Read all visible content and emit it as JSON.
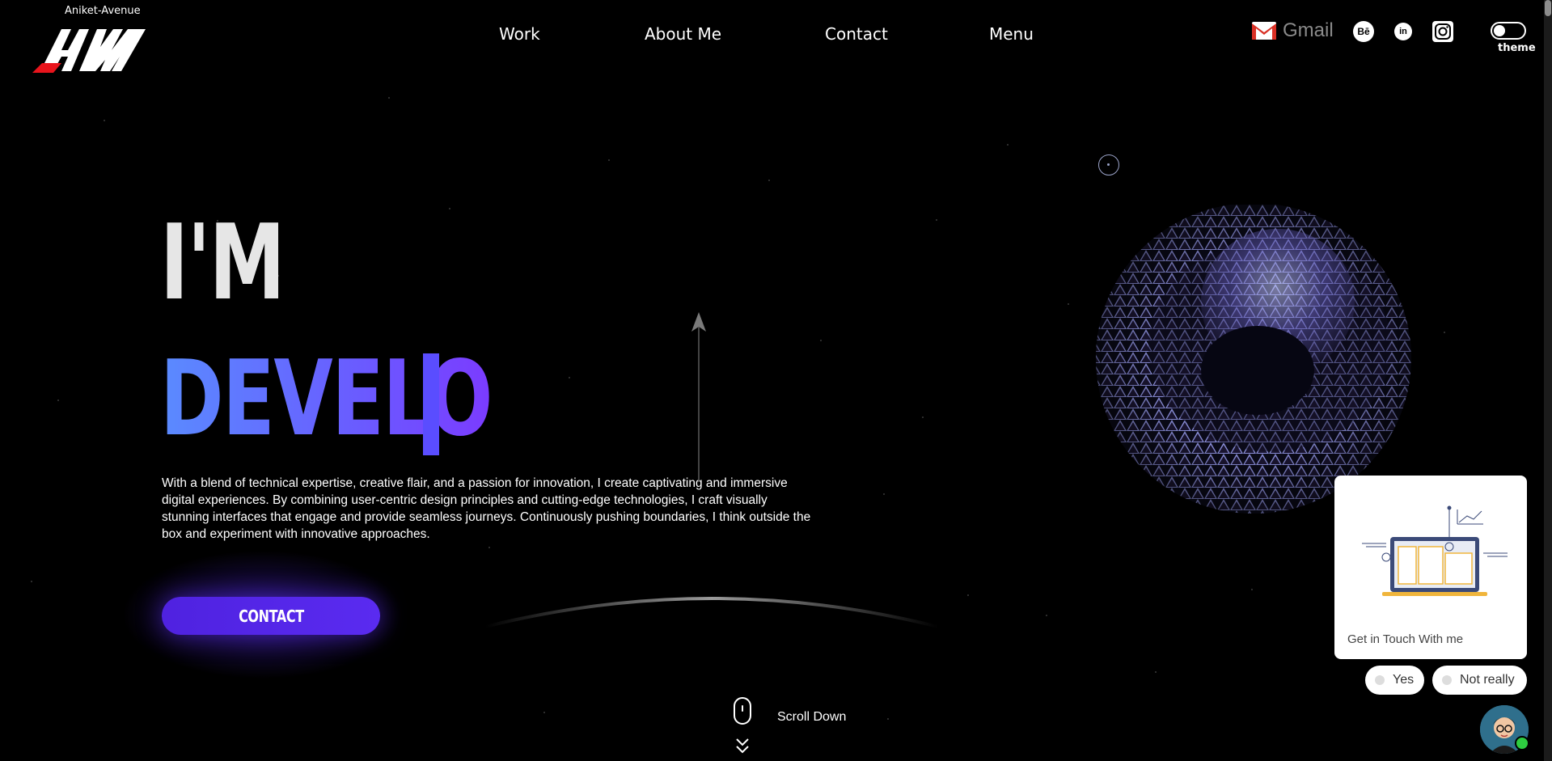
{
  "brand": {
    "name": "Aniket-Avenue"
  },
  "nav": {
    "items": [
      {
        "label": "Work"
      },
      {
        "label": "About Me"
      },
      {
        "label": "Contact"
      },
      {
        "label": "Menu"
      }
    ]
  },
  "social": {
    "gmail_label": "Gmail",
    "behance_glyph": "Bē",
    "linkedin_glyph": "in",
    "icons": [
      "gmail-icon",
      "behance-icon",
      "linkedin-icon",
      "instagram-icon"
    ]
  },
  "theme_toggle": {
    "label": "theme"
  },
  "hero": {
    "prefix": "I'M",
    "typed_role": "DEVELO",
    "description": "With a blend of technical expertise, creative flair, and a passion for innovation, I create captivating and immersive digital experiences. By combining user-centric design principles and cutting-edge technologies, I craft visually stunning interfaces that engage and provide seamless journeys. Continuously pushing boundaries, I think outside the box and experiment with innovative approaches.",
    "cta_label": "CONTACT"
  },
  "scroll": {
    "label": "Scroll Down"
  },
  "chat": {
    "card_text": "Get in Touch With me",
    "options": [
      {
        "label": "Yes"
      },
      {
        "label": "Not really"
      }
    ]
  },
  "colors": {
    "background": "#000000",
    "accent": "#5a2bf0",
    "role_gradient_start": "#5a8bff",
    "role_gradient_end": "#7b3bff",
    "logo_red": "#e8141c"
  }
}
